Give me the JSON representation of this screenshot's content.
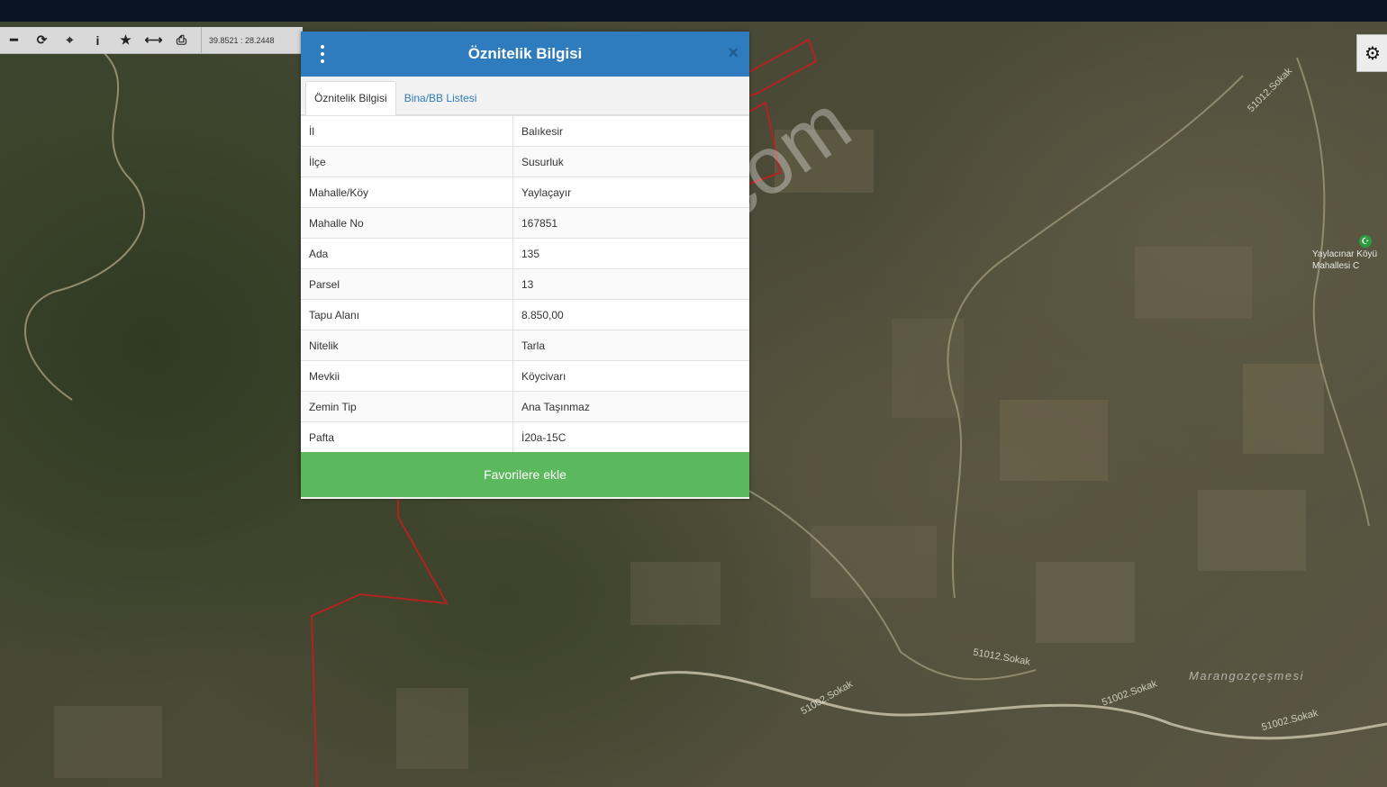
{
  "toolbar": {
    "coordinates": "39.8521 : 28.2448",
    "icons": [
      "zoom-out-icon",
      "refresh-icon",
      "locate-icon",
      "info-icon",
      "star-icon",
      "measure-icon",
      "print-icon"
    ]
  },
  "modal": {
    "title": "Öznitelik Bilgisi",
    "close_label": "×",
    "tabs": [
      {
        "label": "Öznitelik Bilgisi",
        "active": true
      },
      {
        "label": "Bina/BB Listesi",
        "active": false
      }
    ],
    "rows": [
      {
        "key": "İl",
        "value": "Balıkesir"
      },
      {
        "key": "İlçe",
        "value": "Susurluk"
      },
      {
        "key": "Mahalle/Köy",
        "value": "Yaylaçayır"
      },
      {
        "key": "Mahalle No",
        "value": "167851"
      },
      {
        "key": "Ada",
        "value": "135"
      },
      {
        "key": "Parsel",
        "value": "13"
      },
      {
        "key": "Tapu Alanı",
        "value": "8.850,00"
      },
      {
        "key": "Nitelik",
        "value": "Tarla"
      },
      {
        "key": "Mevkii",
        "value": "Köycivarı"
      },
      {
        "key": "Zemin Tip",
        "value": "Ana Taşınmaz"
      },
      {
        "key": "Pafta",
        "value": "İ20a-15C"
      }
    ],
    "favorite_button": "Favorilere ekle"
  },
  "map": {
    "place_label": "Marangozçeşmesi",
    "poi_label_line1": "Yaylacınar Köyü",
    "poi_label_line2": "Mahallesi C",
    "street_labels": [
      "51012.Sokak",
      "51002.Sokak",
      "51002.Sokak",
      "51002.Sokak",
      "51012.Sokak"
    ]
  },
  "watermark": "emlakjet.com",
  "colors": {
    "header_blue": "#2e7bbd",
    "favorite_green": "#5cb85c",
    "parcel_border": "#b22222"
  }
}
